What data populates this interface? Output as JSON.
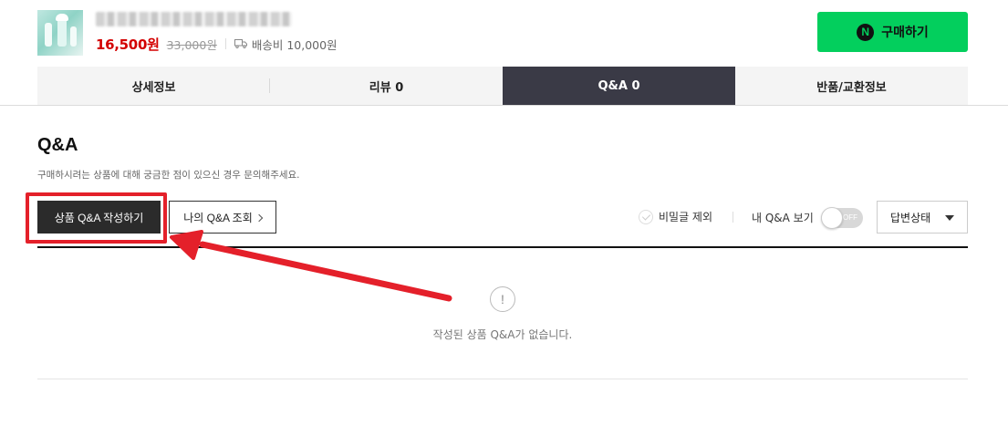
{
  "product": {
    "sale_price": "16,500원",
    "original_price": "33,000원",
    "shipping_fee": "배송비 10,000원"
  },
  "buy_button": {
    "icon_letter": "N",
    "label": "구매하기",
    "color": "#03cf5d"
  },
  "tabs": [
    {
      "label": "상세정보",
      "active": false
    },
    {
      "label": "리뷰 0",
      "active": false
    },
    {
      "label": "Q&A 0",
      "active": true
    },
    {
      "label": "반품/교환정보",
      "active": false
    }
  ],
  "qa": {
    "title": "Q&A",
    "description": "구매하시려는 상품에 대해 궁금한 점이 있으신 경우 문의해주세요.",
    "write_button": "상품 Q&A 작성하기",
    "my_qa_button": "나의 Q&A 조회",
    "exclude_secret_label": "비밀글 제외",
    "my_qa_toggle_label": "내 Q&A 보기",
    "toggle_state": "OFF",
    "status_select": "답변상태",
    "empty_icon": "!",
    "empty_message": "작성된 상품 Q&A가 없습니다."
  },
  "annotation": {
    "highlight_color": "#e4202a"
  }
}
